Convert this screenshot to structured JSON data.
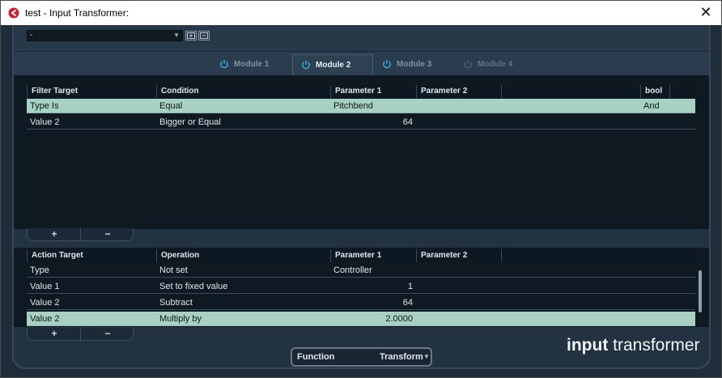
{
  "window": {
    "title": "test - Input Transformer:",
    "close_glyph": "✕"
  },
  "preset": {
    "value": "-"
  },
  "tabs": [
    {
      "label": "Module 1",
      "active": false
    },
    {
      "label": "Module 2",
      "active": true
    },
    {
      "label": "Module 3",
      "active": false
    },
    {
      "label": "Module 4",
      "active": false
    }
  ],
  "filter": {
    "headers": [
      "Filter Target",
      "Condition",
      "Parameter 1",
      "Parameter 2",
      "",
      "bool"
    ],
    "rows": [
      {
        "target": "Type Is",
        "condition": "Equal",
        "param1": "Pitchbend",
        "param2": "",
        "bool": "And",
        "selected": true
      },
      {
        "target": "Value 2",
        "condition": "Bigger or Equal",
        "param1": "64",
        "param2": "",
        "bool": "",
        "selected": false
      }
    ]
  },
  "action": {
    "headers": [
      "Action Target",
      "Operation",
      "Parameter 1",
      "Parameter 2",
      ""
    ],
    "rows": [
      {
        "target": "Type",
        "operation": "Not set",
        "param1": "Controller",
        "selected": false
      },
      {
        "target": "Value 1",
        "operation": "Set to fixed value",
        "param1": "1",
        "selected": false
      },
      {
        "target": "Value 2",
        "operation": "Subtract",
        "param1": "64",
        "selected": false
      },
      {
        "target": "Value 2",
        "operation": "Multiply by",
        "param1": "2.0000",
        "selected": true
      }
    ]
  },
  "buttons": {
    "add": "+",
    "remove": "−"
  },
  "function": {
    "label": "Function",
    "value": "Transform"
  },
  "brand": {
    "bold": "input",
    "rest": " transformer"
  },
  "colors": {
    "selected_row": "#a8d0c3",
    "accent_power": "#2fb0e0",
    "panel_bg": "#0f1922"
  }
}
